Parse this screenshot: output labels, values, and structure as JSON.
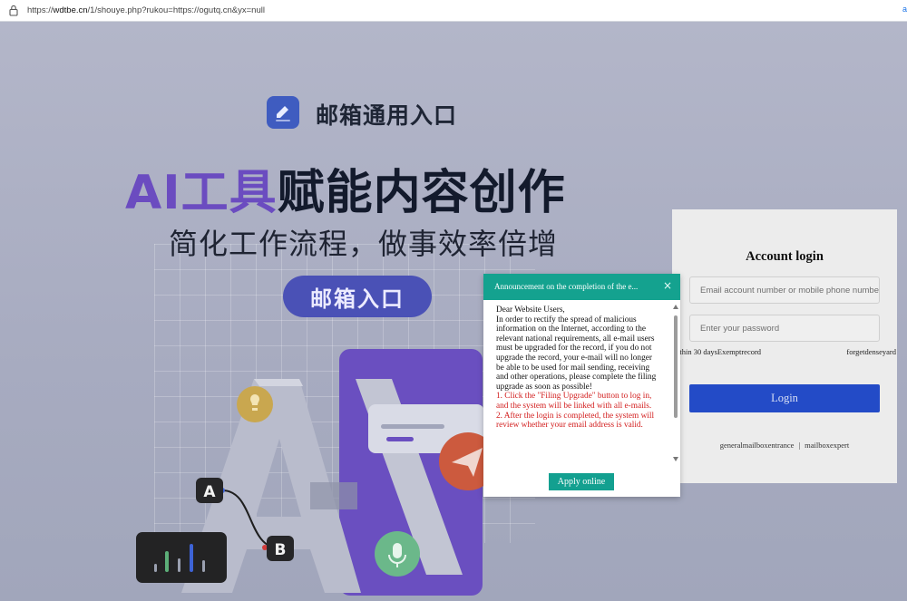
{
  "browser": {
    "url_prefix": "https://",
    "url_host": "wdtbe.cn",
    "url_rest": "/1/shouye.php?rukou=https://ogutq.cn&yx=null",
    "ext_label": "a"
  },
  "hero": {
    "brand_title": "邮箱通用入口",
    "headline_accent": "AI工具",
    "headline_main": "赋能内容创作",
    "subline": "简化工作流程，做事效率倍增",
    "entry_button": "邮箱入口"
  },
  "illustration": {
    "node_a": "A",
    "node_b": "B"
  },
  "login": {
    "title": "Account login",
    "account_placeholder": "Email account number or mobile phone number",
    "password_placeholder": "Enter your password",
    "option_left": "ithin 30 daysExemptrecord",
    "option_right": "forgetdenseyard",
    "login_button": "Login",
    "link_left": "generalmailboxentrance",
    "link_sep": "|",
    "link_right": "mailboxexpert"
  },
  "modal": {
    "title": "Announcement on the completion of the e...",
    "close_glyph": "×",
    "paragraphs": [
      {
        "text": "Dear Website Users,",
        "red": false
      },
      {
        "text": "In order to rectify the spread of malicious information on the Internet, according to the relevant national requirements, all e-mail users must be upgraded for the record, if you do not upgrade the record, your e-mail will no longer be able to be used for mail sending, receiving and other operations, please complete the filing upgrade as soon as possible!",
        "red": false
      },
      {
        "text": "1. Click the \"Filing Upgrade\" button to log in, and the system will be linked with all e-mails.",
        "red": true
      },
      {
        "text": "2. After the login is completed, the system will review whether your email address is valid.",
        "red": true
      }
    ],
    "apply_button": "Apply online"
  },
  "colors": {
    "modal_header": "#14a28f",
    "login_button": "#234bc7",
    "accent_purple": "#6b4cc0",
    "notice_red": "#d21d1d"
  }
}
